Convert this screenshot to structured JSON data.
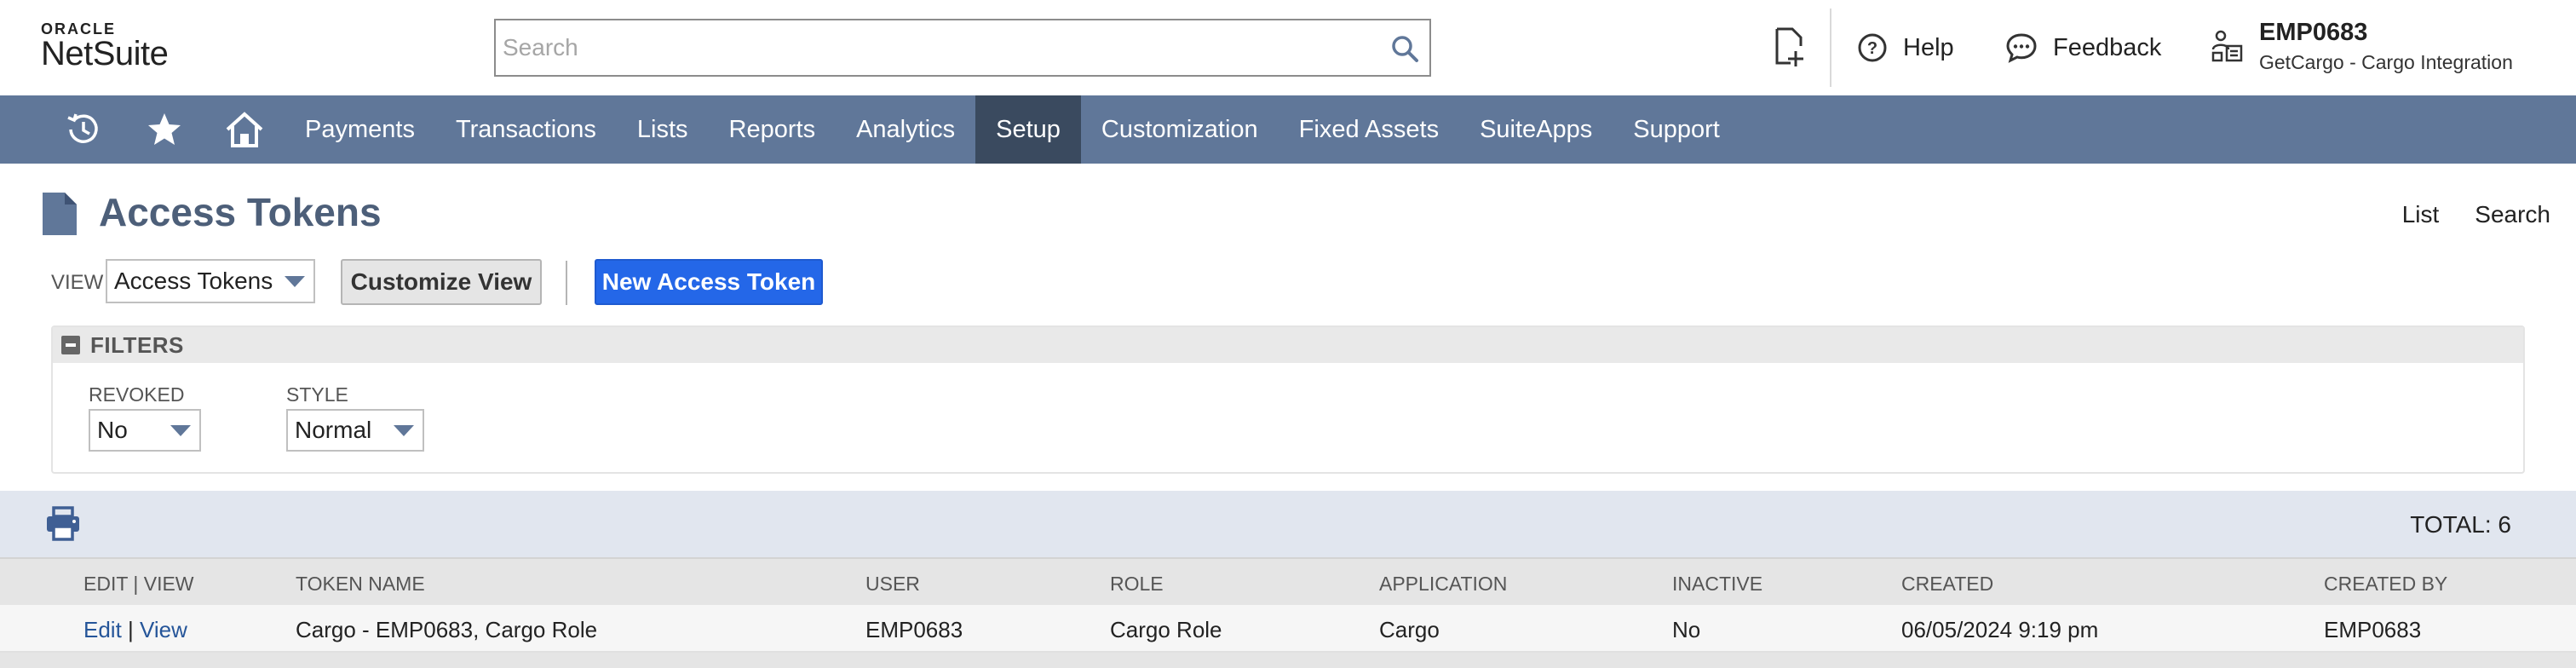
{
  "logo": {
    "oracle": "ORACLE",
    "netsuite": "NetSuite"
  },
  "search": {
    "placeholder": "Search"
  },
  "header": {
    "help_label": "Help",
    "feedback_label": "Feedback",
    "account_id": "EMP0683",
    "account_sub": "GetCargo - Cargo Integration"
  },
  "nav": {
    "items": [
      {
        "label": "Payments"
      },
      {
        "label": "Transactions"
      },
      {
        "label": "Lists"
      },
      {
        "label": "Reports"
      },
      {
        "label": "Analytics"
      },
      {
        "label": "Setup",
        "active": true
      },
      {
        "label": "Customization"
      },
      {
        "label": "Fixed Assets"
      },
      {
        "label": "SuiteApps"
      },
      {
        "label": "Support"
      }
    ]
  },
  "page": {
    "title": "Access Tokens",
    "links": {
      "list": "List",
      "search": "Search"
    }
  },
  "view": {
    "label": "VIEW",
    "selected": "Access Tokens",
    "customize_button": "Customize View",
    "new_button": "New Access Token"
  },
  "filters": {
    "title": "FILTERS",
    "revoked": {
      "label": "REVOKED",
      "value": "No"
    },
    "style": {
      "label": "STYLE",
      "value": "Normal"
    }
  },
  "results": {
    "total": "TOTAL: 6",
    "columns": [
      "EDIT | VIEW",
      "TOKEN NAME",
      "USER",
      "ROLE",
      "APPLICATION",
      "INACTIVE",
      "CREATED",
      "CREATED BY"
    ],
    "rows": [
      {
        "edit": "Edit",
        "sep": " | ",
        "view": "View",
        "token_name": "Cargo - EMP0683, Cargo Role",
        "user": "EMP0683",
        "role": "Cargo Role",
        "application": "Cargo",
        "inactive": "No",
        "created": "06/05/2024 9:19 pm",
        "created_by": "EMP0683"
      }
    ]
  },
  "colors": {
    "nav_bg": "#607799",
    "nav_active": "#3a4a5f",
    "primary_button": "#2467e8",
    "title": "#4d5f79",
    "link": "#255599"
  }
}
